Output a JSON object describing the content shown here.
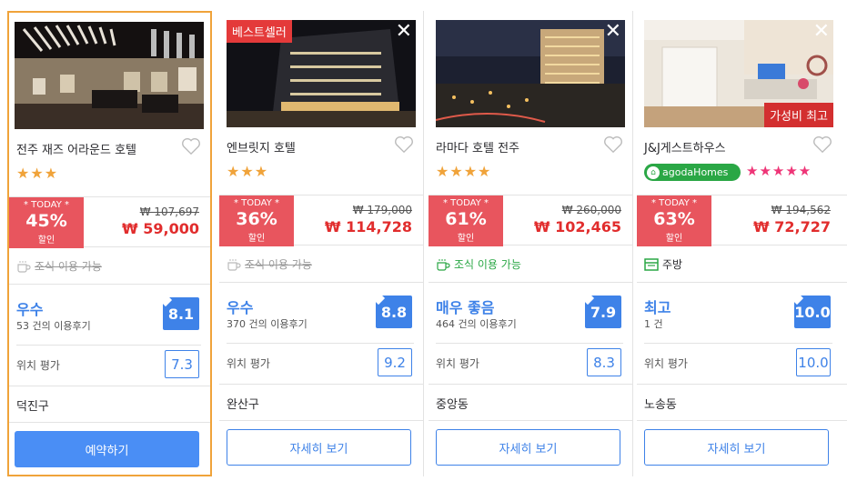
{
  "cards": [
    {
      "name": "전주 재즈 어라운드 호텔",
      "stars": "★★★",
      "today_label": "* TODAY *",
      "discount": "45%",
      "discount_word": "할인",
      "original_price": "₩ 107,697",
      "price": "₩ 59,000",
      "amenity": "조식 이용 가능",
      "rating_label": "우수",
      "review_count": "53 건의 이용후기",
      "score": "8.1",
      "location_label": "위치 평가",
      "location_score": "7.3",
      "area": "덕진구",
      "button": "예약하기"
    },
    {
      "badge": "베스트셀러",
      "name": "엔브릿지 호텔",
      "stars": "★★★",
      "today_label": "* TODAY *",
      "discount": "36%",
      "discount_word": "할인",
      "original_price": "₩ 179,000",
      "price": "₩ 114,728",
      "amenity": "조식 이용 가능",
      "rating_label": "우수",
      "review_count": "370 건의 이용후기",
      "score": "8.8",
      "location_label": "위치 평가",
      "location_score": "9.2",
      "area": "완산구",
      "button": "자세히 보기"
    },
    {
      "name": "라마다 호텔 전주",
      "stars": "★★★★",
      "today_label": "* TODAY *",
      "discount": "61%",
      "discount_word": "할인",
      "original_price": "₩ 260,000",
      "price": "₩ 102,465",
      "amenity": "조식 이용 가능",
      "rating_label": "매우 좋음",
      "review_count": "464 건의 이용후기",
      "score": "7.9",
      "location_label": "위치 평가",
      "location_score": "8.3",
      "area": "중앙동",
      "button": "자세히 보기"
    },
    {
      "badge_bottom": "가성비 최고",
      "name": "J&J게스트하우스",
      "brand": "agodaHomes",
      "stars": "★★★★★",
      "today_label": "* TODAY *",
      "discount": "63%",
      "discount_word": "할인",
      "original_price": "₩ 194,562",
      "price": "₩ 72,727",
      "amenity": "주방",
      "rating_label": "최고",
      "review_count": "1 건",
      "score": "10.0",
      "location_label": "위치 평가",
      "location_score": "10.0",
      "area": "노송동",
      "button": "자세히 보기"
    }
  ],
  "colors": {
    "accent": "#3e82e8",
    "sale": "#e8555e",
    "selected_border": "#f0a33a",
    "star": "#f0a33a"
  }
}
